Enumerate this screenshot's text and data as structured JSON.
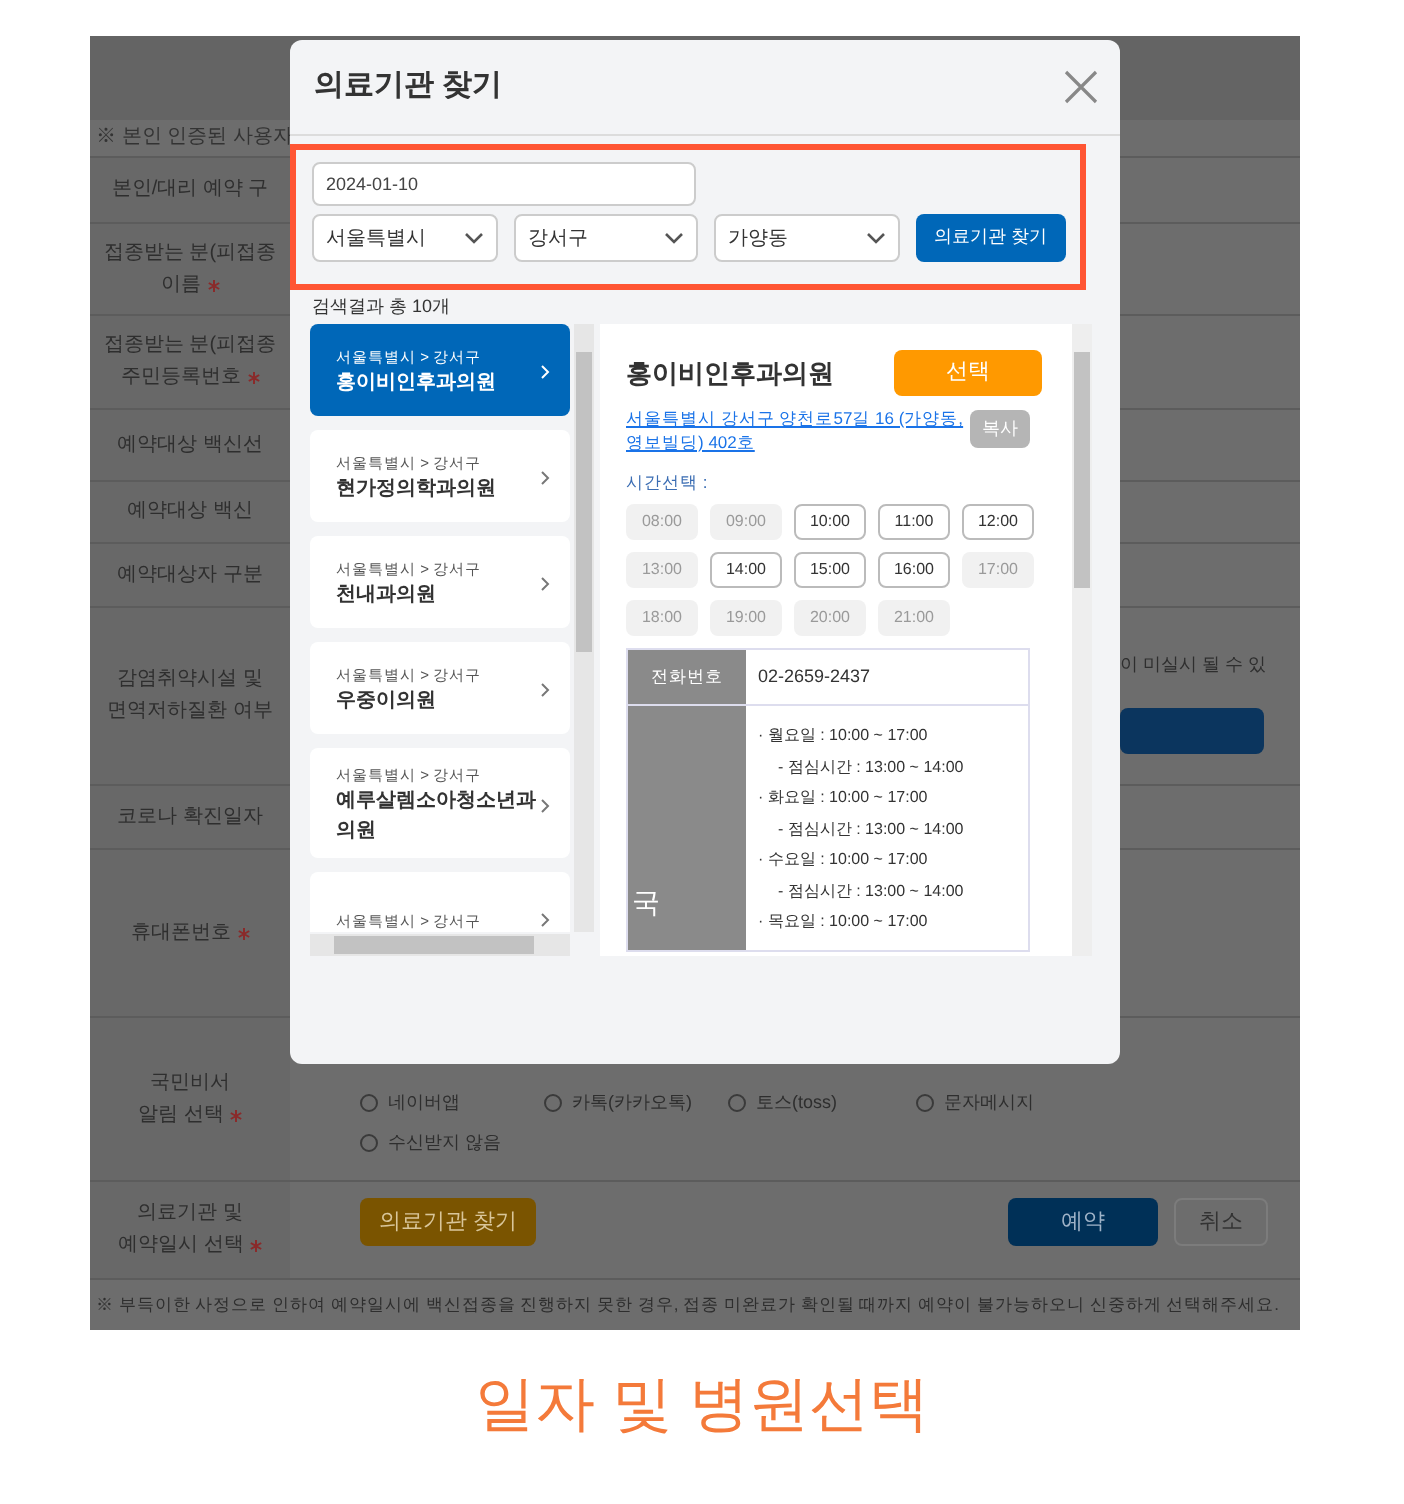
{
  "form": {
    "notice": "※ 본인 인증된 사용자",
    "rows": [
      {
        "label": [
          "본인/대리 예약 구"
        ],
        "required": false
      },
      {
        "label": [
          "접종받는 분(피접종",
          "이름"
        ],
        "required": true
      },
      {
        "label": [
          "접종받는 분(피접종",
          "주민등록번호"
        ],
        "required": true
      },
      {
        "label": [
          "예약대상 백신선"
        ],
        "required": false
      },
      {
        "label": [
          "예약대상 백신"
        ],
        "required": false
      },
      {
        "label": [
          "예약대상자 구분"
        ],
        "required": false
      },
      {
        "label": [
          "감염취약시설 및",
          "면역저하질환 여부"
        ],
        "required": false,
        "content": {
          "kind": "note",
          "text": "이 미실시 될 수 있"
        }
      },
      {
        "label": [
          "코로나 확진일자"
        ],
        "required": false
      },
      {
        "label": [
          "휴대폰번호"
        ],
        "required": true
      },
      {
        "label": [
          "국민비서",
          "알림 선택"
        ],
        "required": true,
        "content": {
          "kind": "radios",
          "options": [
            {
              "label": "네이버앱",
              "selected": false
            },
            {
              "label": "카톡(카카오톡)",
              "selected": false
            },
            {
              "label": "토스(toss)",
              "selected": false
            },
            {
              "label": "문자메시지",
              "selected": false
            },
            {
              "label": "수신받지 않음",
              "selected": false
            }
          ]
        }
      },
      {
        "label": [
          "의료기관 및",
          "예약일시 선택"
        ],
        "required": true,
        "content": {
          "kind": "actions",
          "buttons": [
            {
              "label": "의료기관 찾기"
            },
            {
              "label": "예약"
            },
            {
              "label": "취소"
            }
          ]
        }
      }
    ],
    "footnote": "※ 부득이한 사정으로 인하여 예약일시에 백신접종을 진행하지 못한 경우, 접종 미완료가 확인될 때까지 예약이 불가능하오니 신중하게 선택해주세요."
  },
  "modal": {
    "title": "의료기관 찾기",
    "date": "2024-01-10",
    "selects": [
      "서울특별시",
      "강서구",
      "가양동"
    ],
    "search_button": "의료기관 찾기",
    "result_count": "검색결과 총 10개",
    "results": [
      {
        "region": "서울특별시 > 강서구",
        "name": "홍이비인후과의원",
        "selected": true
      },
      {
        "region": "서울특별시 > 강서구",
        "name": "현가정의학과의원",
        "selected": false
      },
      {
        "region": "서울특별시 > 강서구",
        "name": "천내과의원",
        "selected": false
      },
      {
        "region": "서울특별시 > 강서구",
        "name": "우중이의원",
        "selected": false
      },
      {
        "region": "서울특별시 > 강서구",
        "name": "예루살렘소아청소년과의원",
        "selected": false
      },
      {
        "region": "서울특별시 > 강서구",
        "selected": false
      }
    ],
    "detail": {
      "name": "홍이비인후과의원",
      "select_button": "선택",
      "address": "서울특별시 강서구 양천로57길 16 (가양동, 영보빌딩) 402호",
      "copy_button": "복사",
      "copy_disabled": true,
      "time_label": "시간선택 :",
      "times": [
        {
          "label": "08:00",
          "disabled": true
        },
        {
          "label": "09:00",
          "disabled": true
        },
        {
          "label": "10:00",
          "disabled": false
        },
        {
          "label": "11:00",
          "disabled": false
        },
        {
          "label": "12:00",
          "disabled": false
        },
        {
          "label": "13:00",
          "disabled": true
        },
        {
          "label": "14:00",
          "disabled": false
        },
        {
          "label": "15:00",
          "disabled": false
        },
        {
          "label": "16:00",
          "disabled": false
        },
        {
          "label": "17:00",
          "disabled": true
        },
        {
          "label": "18:00",
          "disabled": true
        },
        {
          "label": "19:00",
          "disabled": true
        },
        {
          "label": "20:00",
          "disabled": true
        },
        {
          "label": "21:00",
          "disabled": true
        }
      ],
      "phone_label": "전화번호",
      "phone": "02-2659-2437",
      "hours_label": "국",
      "hours": [
        {
          "kind": "day",
          "text": "· 월요일 : 10:00 ~ 17:00"
        },
        {
          "kind": "lunch",
          "text": "- 점심시간 : 13:00 ~ 14:00"
        },
        {
          "kind": "day",
          "text": "· 화요일 : 10:00 ~ 17:00"
        },
        {
          "kind": "lunch",
          "text": "- 점심시간 : 13:00 ~ 14:00"
        },
        {
          "kind": "day",
          "text": "· 수요일 : 10:00 ~ 17:00"
        },
        {
          "kind": "lunch",
          "text": "- 점심시간 : 13:00 ~ 14:00"
        },
        {
          "kind": "day",
          "text": "· 목요일 : 10:00 ~ 17:00"
        }
      ]
    }
  },
  "caption": "일자 및 병원선택"
}
